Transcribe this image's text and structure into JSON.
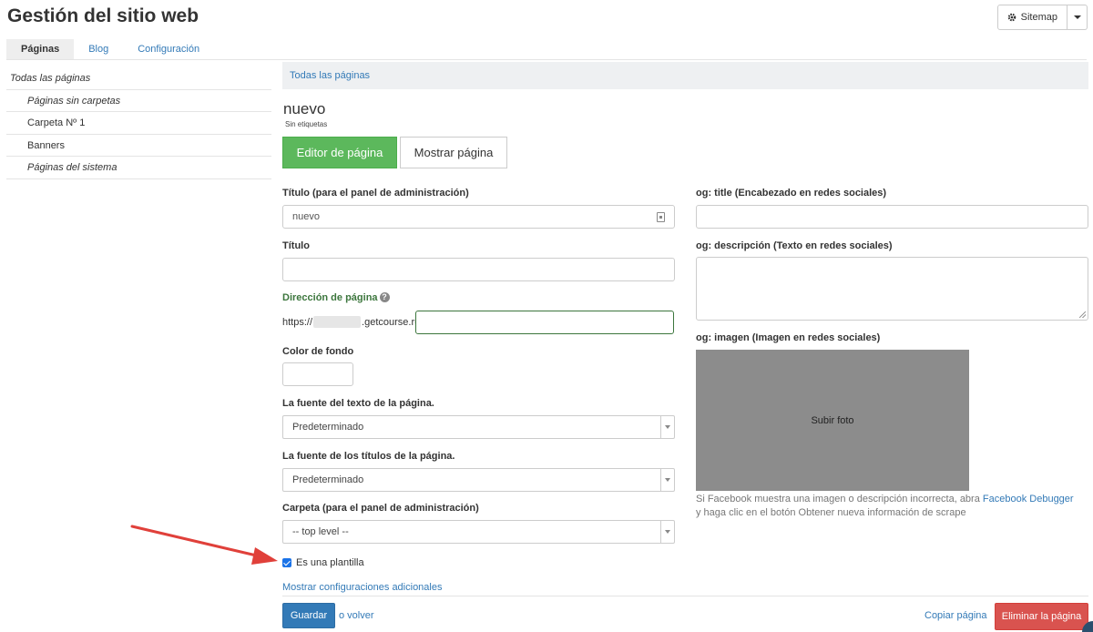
{
  "header": {
    "title": "Gestión del sitio web",
    "sitemap_label": "Sitemap"
  },
  "tabs": [
    {
      "label": "Páginas",
      "active": true
    },
    {
      "label": "Blog"
    },
    {
      "label": "Configuración"
    }
  ],
  "sidebar": {
    "items": [
      {
        "label": "Todas las páginas"
      },
      {
        "label": "Páginas sin carpetas"
      },
      {
        "label": "Carpeta Nº 1"
      },
      {
        "label": "Banners"
      },
      {
        "label": "Páginas del sistema"
      }
    ]
  },
  "breadcrumb": {
    "label": "Todas las páginas"
  },
  "page": {
    "name": "nuevo",
    "tags": "Sin etiquetas"
  },
  "buttons": {
    "editor": "Editor de página",
    "view": "Mostrar página"
  },
  "form": {
    "admin_title_label": "Título (para el panel de administración)",
    "admin_title_value": "nuevo",
    "title_label": "Título",
    "title_value": "",
    "address_label": "Dirección de página",
    "address_prefix_start": "https://",
    "address_prefix_end": ".getcourse.ru/",
    "address_value": "",
    "bg_color_label": "Color de fondo",
    "bg_color_value": "",
    "font_text_label": "La fuente del texto de la página.",
    "font_text_value": "Predeterminado",
    "font_titles_label": "La fuente de los títulos de la página.",
    "font_titles_value": "Predeterminado",
    "folder_label": "Carpeta (para el panel de administración)",
    "folder_value": "-- top level --",
    "template_label": "Es una plantilla",
    "template_checked": true,
    "more_settings": "Mostrar configuraciones adicionales"
  },
  "social": {
    "og_title_label": "og: title (Encabezado en redes sociales)",
    "og_title_value": "",
    "og_description_label": "og: descripción (Texto en redes sociales)",
    "og_description_value": "",
    "og_image_label": "og: imagen (Imagen en redes sociales)",
    "upload_label": "Subir foto",
    "note_before": "Si Facebook muestra una imagen o descripción incorrecta, abra",
    "note_link": "Facebook Debugger",
    "note_after": "y haga clic en el botón Obtener nueva información de scrape"
  },
  "footer": {
    "save": "Guardar",
    "back": "o volver",
    "copy": "Copiar página",
    "delete": "Eliminar la página"
  },
  "colors": {
    "primary": "#337ab7",
    "success": "#5cb85c",
    "danger": "#d9534f",
    "annotation_arrow": "#e0403a"
  },
  "icons": {
    "sitemap": "gear-icon",
    "dropdown": "chevron-down-icon",
    "help": "question-circle-icon",
    "password_manager": "key-icon",
    "annotation": "red-arrow-icon"
  }
}
